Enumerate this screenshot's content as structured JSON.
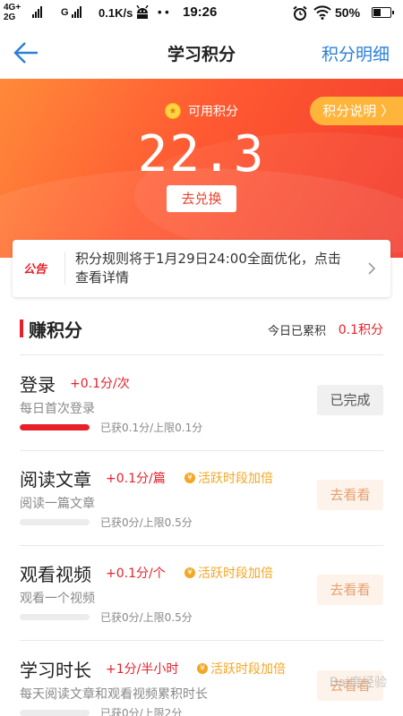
{
  "status_bar": {
    "network": "4G+",
    "network2": "2G",
    "sim2": "G",
    "speed": "0.1K/s",
    "dots": "• •",
    "time": "19:26",
    "battery": "50%",
    "battery_level": 0.5
  },
  "nav": {
    "title": "学习积分",
    "detail_label": "积分明细"
  },
  "hero": {
    "label": "可用积分",
    "points": "22.3",
    "exchange_label": "去兑换",
    "explain_label": "积分说明 〉"
  },
  "notice": {
    "badge": "公告",
    "text": "积分规则将于1月29日24:00全面优化，点击查看详情"
  },
  "section": {
    "title": "赚积分",
    "today_label": "今日已累积",
    "today_value": "0.1积分"
  },
  "tasks": [
    {
      "name": "登录",
      "rate": "+0.1分/次",
      "bonus": "",
      "desc": "每日首次登录",
      "got": "已获0.1分/上限0.1分",
      "progress": 1.0,
      "button": "已完成"
    },
    {
      "name": "阅读文章",
      "rate": "+0.1分/篇",
      "bonus": "活跃时段加倍",
      "desc": "阅读一篇文章",
      "got": "已获0分/上限0.5分",
      "progress": 0,
      "button": "去看看"
    },
    {
      "name": "观看视频",
      "rate": "+0.1分/个",
      "bonus": "活跃时段加倍",
      "desc": "观看一个视频",
      "got": "已获0分/上限0.5分",
      "progress": 0,
      "button": "去看看"
    },
    {
      "name": "学习时长",
      "rate": "+1分/半小时",
      "bonus": "活跃时段加倍",
      "desc": "每天阅读文章和观看视频累积时长",
      "got": "已获0分/上限2分",
      "progress": 0,
      "button": "去看看"
    }
  ],
  "watermark": "Bai度经验",
  "colors": {
    "accent_red": "#e8202a",
    "nav_blue": "#2a7fd8",
    "bonus_orange": "#f5a623",
    "hero_gradient_start": "#ff8a3a",
    "hero_gradient_end": "#f23a2c"
  }
}
